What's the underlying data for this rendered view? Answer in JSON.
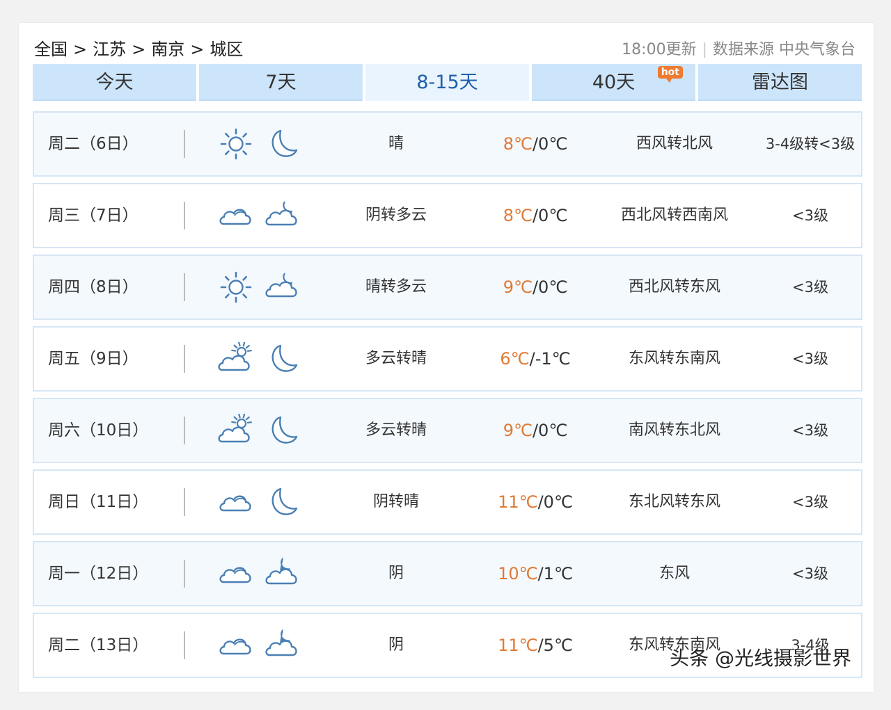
{
  "breadcrumb": {
    "items": [
      "全国",
      "江苏",
      "南京",
      "城区"
    ],
    "separator": ">"
  },
  "meta": {
    "update_time": "18:00更新",
    "divider": "|",
    "source": "数据来源 中央气象台"
  },
  "tabs": [
    {
      "label": "今天"
    },
    {
      "label": "7天"
    },
    {
      "label": "8-15天"
    },
    {
      "label": "40天",
      "badge": "hot"
    },
    {
      "label": "雷达图"
    }
  ],
  "active_tab": "8-15天",
  "colors": {
    "tab_bg": "#cce5fb",
    "tab_active_bg": "#e9f4fe",
    "tab_active_text": "#1f5fa8",
    "high_temp": "#e07a34",
    "icon_stroke": "#4a7fb3",
    "badge": "#ee7b2f"
  },
  "forecast": [
    {
      "day": "周二（6日）",
      "icon_day": "sun-icon",
      "icon_night": "moon-icon",
      "desc": "晴",
      "high": "8℃",
      "low": "0℃",
      "wind": "西风转北风",
      "level": "3-4级转<3级"
    },
    {
      "day": "周三（7日）",
      "icon_day": "cloud-icon",
      "icon_night": "cloudy-night-icon",
      "desc": "阴转多云",
      "high": "8℃",
      "low": "0℃",
      "wind": "西北风转西南风",
      "level": "<3级"
    },
    {
      "day": "周四（8日）",
      "icon_day": "sun-icon",
      "icon_night": "cloudy-night-icon",
      "desc": "晴转多云",
      "high": "9℃",
      "low": "0℃",
      "wind": "西北风转东风",
      "level": "<3级"
    },
    {
      "day": "周五（9日）",
      "icon_day": "partly-cloudy-icon",
      "icon_night": "moon-icon",
      "desc": "多云转晴",
      "high": "6℃",
      "low": "-1℃",
      "wind": "东风转东南风",
      "level": "<3级"
    },
    {
      "day": "周六（10日）",
      "icon_day": "partly-cloudy-icon",
      "icon_night": "moon-icon",
      "desc": "多云转晴",
      "high": "9℃",
      "low": "0℃",
      "wind": "南风转东北风",
      "level": "<3级"
    },
    {
      "day": "周日（11日）",
      "icon_day": "cloud-icon",
      "icon_night": "moon-icon",
      "desc": "阴转晴",
      "high": "11℃",
      "low": "0℃",
      "wind": "东北风转东风",
      "level": "<3级"
    },
    {
      "day": "周一（12日）",
      "icon_day": "cloud-icon",
      "icon_night": "cloud-moon-icon",
      "desc": "阴",
      "high": "10℃",
      "low": "1℃",
      "wind": "东风",
      "level": "<3级"
    },
    {
      "day": "周二（13日）",
      "icon_day": "cloud-icon",
      "icon_night": "cloud-moon-icon",
      "desc": "阴",
      "high": "11℃",
      "low": "5℃",
      "wind": "东风转东南风",
      "level": "3-4级"
    }
  ],
  "watermark": "头条 @光线摄影世界"
}
